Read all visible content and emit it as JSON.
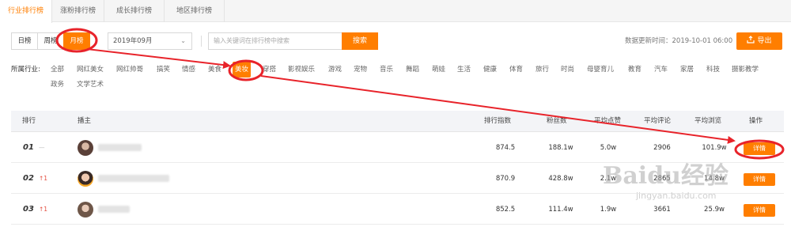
{
  "tabs": [
    "行业排行榜",
    "涨粉排行榜",
    "成长排行榜",
    "地区排行榜"
  ],
  "period": {
    "day": "日榜",
    "week": "周榜",
    "month": "月榜"
  },
  "month_select": "2019年09月",
  "search": {
    "placeholder": "输入关键词在排行榜中搜索",
    "button": "搜索"
  },
  "update_time": "数据更新时间：2019-10-01 06:00",
  "export": "导出",
  "industry_label": "所属行业:",
  "categories": [
    "全部",
    "网红美女",
    "网红帅哥",
    "搞笑",
    "情感",
    "美食",
    "美妆",
    "穿搭",
    "影视娱乐",
    "游戏",
    "宠物",
    "音乐",
    "舞蹈",
    "萌娃",
    "生活",
    "健康",
    "体育",
    "旅行",
    "时尚",
    "母婴育儿",
    "教育",
    "汽车",
    "家居",
    "科技",
    "摄影教学",
    "政务",
    "文学艺术"
  ],
  "table": {
    "headers": {
      "rank": "排行",
      "host": "播主",
      "index": "排行指数",
      "fans": "粉丝数",
      "likes": "平均点赞",
      "comments": "平均评论",
      "views": "平均浏览",
      "action": "操作"
    },
    "rows": [
      {
        "rank": "01",
        "trend": "—",
        "index": "874.5",
        "fans": "188.1w",
        "likes": "5.0w",
        "comments": "2906",
        "views": "101.9w",
        "action": "详情"
      },
      {
        "rank": "02",
        "trend": "↑1",
        "index": "870.9",
        "fans": "428.8w",
        "likes": "2.1w",
        "comments": "2865",
        "views": "14.8w",
        "action": "详情"
      },
      {
        "rank": "03",
        "trend": "↑1",
        "index": "852.5",
        "fans": "111.4w",
        "likes": "1.9w",
        "comments": "3661",
        "views": "25.9w",
        "action": "详情"
      }
    ]
  },
  "watermark": {
    "logo": "Baidu经验",
    "url": "jingyan.baidu.com"
  },
  "colors": {
    "accent": "#ff7e00",
    "annotation": "#e8232a",
    "trend_up": "#e34b3c"
  }
}
